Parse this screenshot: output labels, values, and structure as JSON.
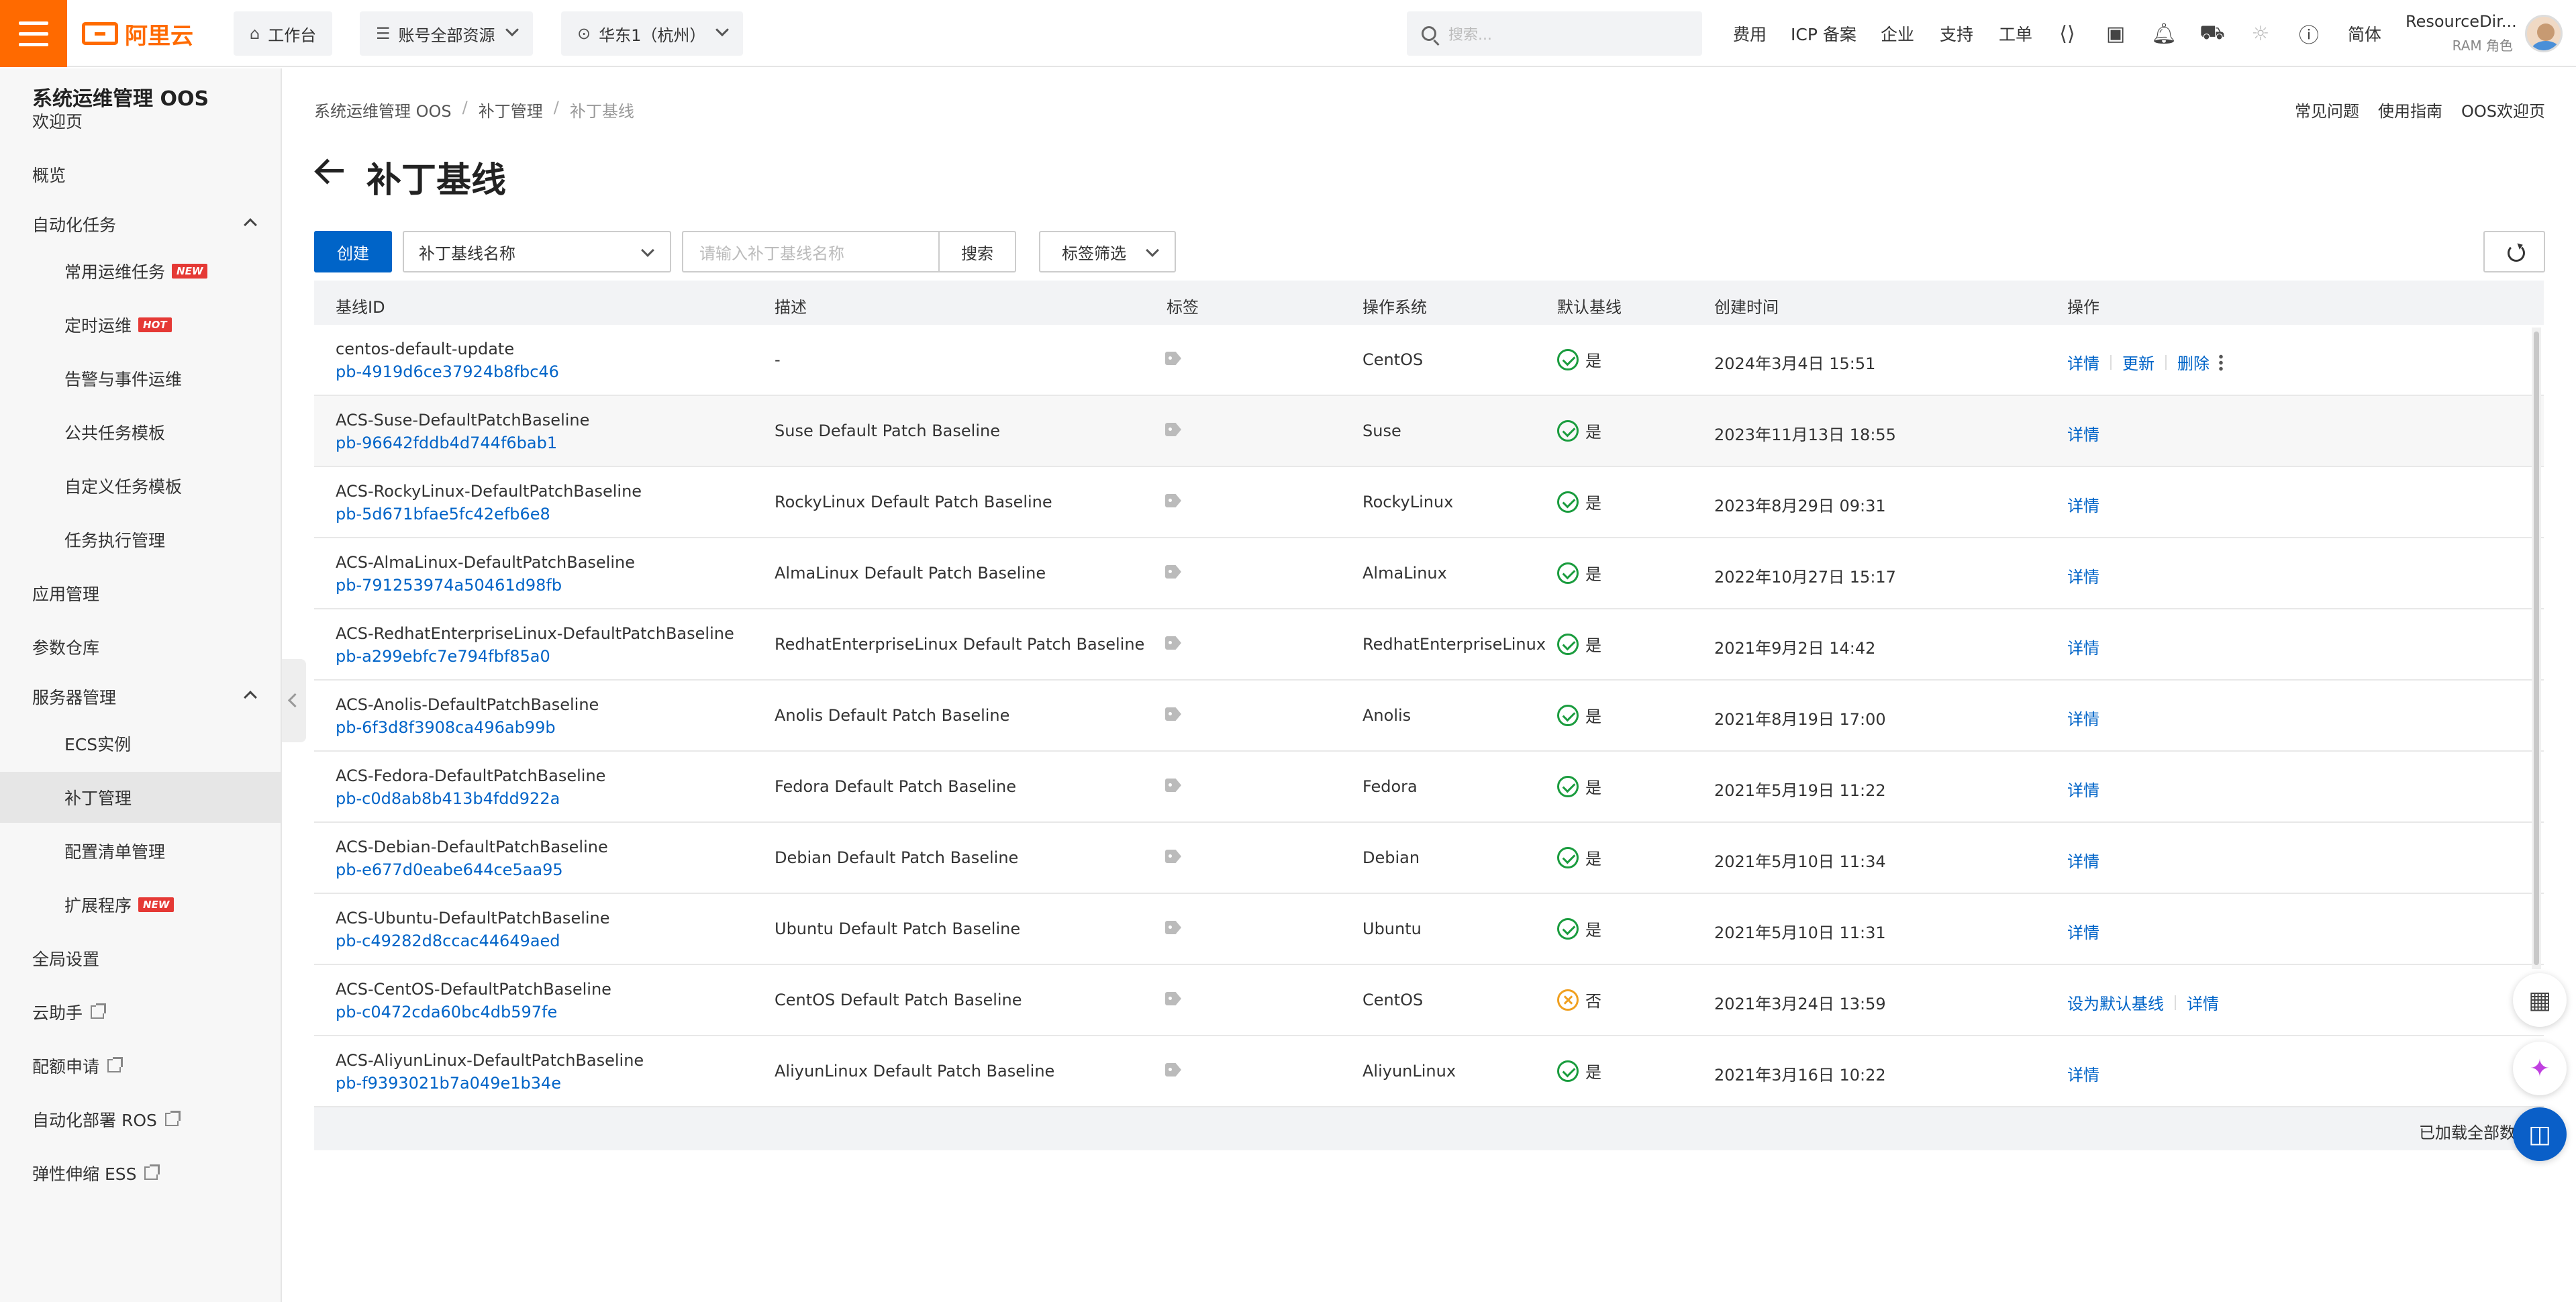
{
  "topbar": {
    "logo": "阿里云",
    "workbench": "工作台",
    "resources": "账号全部资源",
    "region": "华东1（杭州）",
    "search_placeholder": "搜索...",
    "links": [
      "费用",
      "ICP 备案",
      "企业",
      "支持",
      "工单"
    ],
    "lang": "简体",
    "account_name": "ResourceDir...",
    "account_role": "RAM 角色"
  },
  "sidebar": {
    "title": "系统运维管理 OOS",
    "items": [
      {
        "label": "欢迎页",
        "level": 1
      },
      {
        "label": "概览",
        "level": 1
      },
      {
        "label": "自动化任务",
        "level": 1,
        "expandable": true
      },
      {
        "label": "常用运维任务",
        "level": 2,
        "badge": "NEW"
      },
      {
        "label": "定时运维",
        "level": 2,
        "badge": "HOT"
      },
      {
        "label": "告警与事件运维",
        "level": 2
      },
      {
        "label": "公共任务模板",
        "level": 2
      },
      {
        "label": "自定义任务模板",
        "level": 2
      },
      {
        "label": "任务执行管理",
        "level": 2
      },
      {
        "label": "应用管理",
        "level": 1
      },
      {
        "label": "参数仓库",
        "level": 1
      },
      {
        "label": "服务器管理",
        "level": 1,
        "expandable": true
      },
      {
        "label": "ECS实例",
        "level": 2
      },
      {
        "label": "补丁管理",
        "level": 2,
        "active": true
      },
      {
        "label": "配置清单管理",
        "level": 2
      },
      {
        "label": "扩展程序",
        "level": 2,
        "badge": "NEW"
      },
      {
        "label": "全局设置",
        "level": 1
      },
      {
        "label": "云助手",
        "level": 1,
        "external": true
      },
      {
        "label": "配额申请",
        "level": 1,
        "external": true
      },
      {
        "label": "自动化部署 ROS",
        "level": 1,
        "external": true
      },
      {
        "label": "弹性伸缩 ESS",
        "level": 1,
        "external": true
      }
    ]
  },
  "breadcrumb": [
    "系统运维管理 OOS",
    "补丁管理",
    "补丁基线"
  ],
  "help_links": [
    "常见问题",
    "使用指南",
    "OOS欢迎页"
  ],
  "page_title": "补丁基线",
  "toolbar": {
    "create": "创建",
    "filter_field": "补丁基线名称",
    "search_placeholder": "请输入补丁基线名称",
    "search": "搜索",
    "tag_filter": "标签筛选"
  },
  "table": {
    "headers": [
      "基线ID",
      "描述",
      "标签",
      "操作系统",
      "默认基线",
      "创建时间",
      "操作"
    ],
    "rows": [
      {
        "name": "centos-default-update",
        "id": "pb-4919d6ce37924b8fbc46",
        "desc": "-",
        "os": "CentOS",
        "default": "是",
        "is_default": true,
        "created": "2024年3月4日 15:51",
        "ops": [
          "详情",
          "更新",
          "删除"
        ],
        "more": true
      },
      {
        "name": "ACS-Suse-DefaultPatchBaseline",
        "id": "pb-96642fddb4d744f6bab1",
        "desc": "Suse Default Patch Baseline",
        "os": "Suse",
        "default": "是",
        "is_default": true,
        "created": "2023年11月13日 18:55",
        "ops": [
          "详情"
        ]
      },
      {
        "name": "ACS-RockyLinux-DefaultPatchBaseline",
        "id": "pb-5d671bfae5fc42efb6e8",
        "desc": "RockyLinux Default Patch Baseline",
        "os": "RockyLinux",
        "default": "是",
        "is_default": true,
        "created": "2023年8月29日 09:31",
        "ops": [
          "详情"
        ]
      },
      {
        "name": "ACS-AlmaLinux-DefaultPatchBaseline",
        "id": "pb-791253974a50461d98fb",
        "desc": "AlmaLinux Default Patch Baseline",
        "os": "AlmaLinux",
        "default": "是",
        "is_default": true,
        "created": "2022年10月27日 15:17",
        "ops": [
          "详情"
        ]
      },
      {
        "name": "ACS-RedhatEnterpriseLinux-DefaultPatchBaseline",
        "id": "pb-a299ebfc7e794fbf85a0",
        "desc": "RedhatEnterpriseLinux Default Patch Baseline",
        "os": "RedhatEnterpriseLinux",
        "default": "是",
        "is_default": true,
        "created": "2021年9月2日 14:42",
        "ops": [
          "详情"
        ]
      },
      {
        "name": "ACS-Anolis-DefaultPatchBaseline",
        "id": "pb-6f3d8f3908ca496ab99b",
        "desc": "Anolis Default Patch Baseline",
        "os": "Anolis",
        "default": "是",
        "is_default": true,
        "created": "2021年8月19日 17:00",
        "ops": [
          "详情"
        ]
      },
      {
        "name": "ACS-Fedora-DefaultPatchBaseline",
        "id": "pb-c0d8ab8b413b4fdd922a",
        "desc": "Fedora Default Patch Baseline",
        "os": "Fedora",
        "default": "是",
        "is_default": true,
        "created": "2021年5月19日 11:22",
        "ops": [
          "详情"
        ]
      },
      {
        "name": "ACS-Debian-DefaultPatchBaseline",
        "id": "pb-e677d0eabe644ce5aa95",
        "desc": "Debian Default Patch Baseline",
        "os": "Debian",
        "default": "是",
        "is_default": true,
        "created": "2021年5月10日 11:34",
        "ops": [
          "详情"
        ]
      },
      {
        "name": "ACS-Ubuntu-DefaultPatchBaseline",
        "id": "pb-c49282d8ccac44649aed",
        "desc": "Ubuntu Default Patch Baseline",
        "os": "Ubuntu",
        "default": "是",
        "is_default": true,
        "created": "2021年5月10日 11:31",
        "ops": [
          "详情"
        ]
      },
      {
        "name": "ACS-CentOS-DefaultPatchBaseline",
        "id": "pb-c0472cda60bc4db597fe",
        "desc": "CentOS Default Patch Baseline",
        "os": "CentOS",
        "default": "否",
        "is_default": false,
        "created": "2021年3月24日 13:59",
        "ops": [
          "设为默认基线",
          "详情"
        ]
      },
      {
        "name": "ACS-AliyunLinux-DefaultPatchBaseline",
        "id": "pb-f9393021b7a049e1b34e",
        "desc": "AliyunLinux Default Patch Baseline",
        "os": "AliyunLinux",
        "default": "是",
        "is_default": true,
        "created": "2021年3月16日 10:22",
        "ops": [
          "详情"
        ]
      }
    ],
    "footer": "已加载全部数据"
  },
  "colors": {
    "brand": "#ff6a00",
    "primary": "#0064c8",
    "success": "#1a9c3e",
    "warning": "#f0a020"
  }
}
